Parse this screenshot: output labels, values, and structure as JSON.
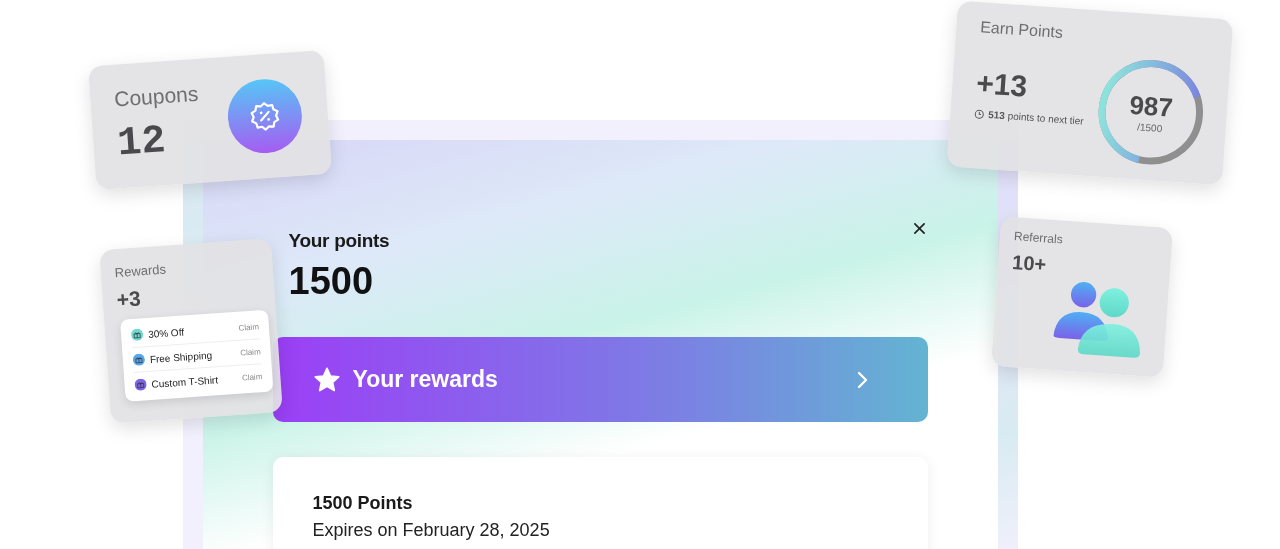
{
  "coupons_card": {
    "title": "Coupons",
    "count": "12"
  },
  "earn_points_card": {
    "title": "Earn Points",
    "gain": "+13",
    "next_tier_count": "513",
    "next_tier_text": "points to next tier",
    "total": "987",
    "goal": "/1500",
    "level": 0.66
  },
  "rewards_card": {
    "title": "Rewards",
    "count": "+3",
    "items": [
      {
        "label": "30% Off",
        "action": "Claim",
        "color": "#6fd8d0"
      },
      {
        "label": "Free Shipping",
        "action": "Claim",
        "color": "#5aa6e8"
      },
      {
        "label": "Custom T-Shirt",
        "action": "Claim",
        "color": "#7d63e6"
      }
    ]
  },
  "referrals_card": {
    "title": "Referrals",
    "count": "10+"
  },
  "points_panel": {
    "title": "Your points",
    "value": "1500",
    "rewards_button": "Your rewards",
    "summary": {
      "heading": "1500 Points",
      "expiry": "Expires on February 28, 2025"
    }
  }
}
